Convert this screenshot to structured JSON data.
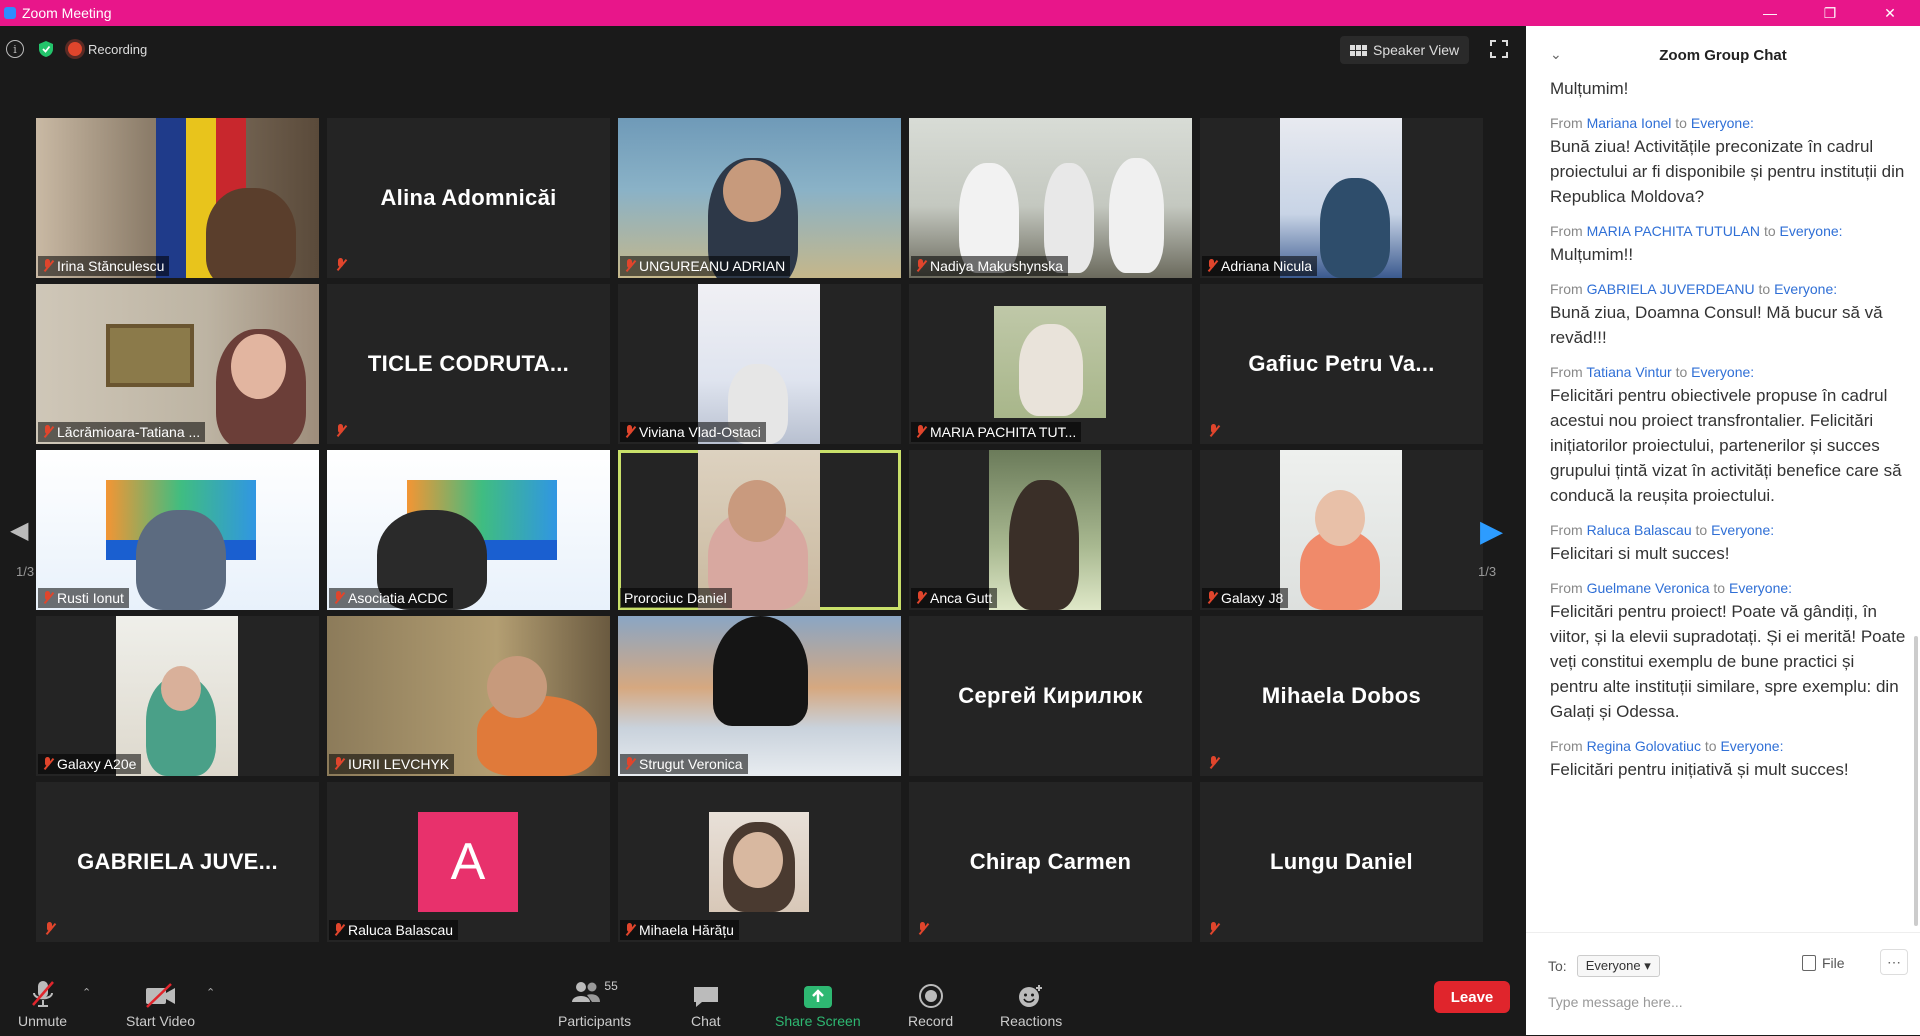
{
  "window": {
    "title": "Zoom Meeting"
  },
  "topbar": {
    "recording_label": "Recording",
    "speaker_view_label": "Speaker View"
  },
  "tiles": [
    {
      "name": "Irina Stănculescu",
      "big_name": ""
    },
    {
      "name": "",
      "big_name": "Alina Adomnicăi"
    },
    {
      "name": "UNGUREANU ADRIAN",
      "big_name": ""
    },
    {
      "name": "Nadiya Makushynska",
      "big_name": ""
    },
    {
      "name": "Adriana Nicula",
      "big_name": ""
    },
    {
      "name": "Lăcrămioara-Tatiana ...",
      "big_name": ""
    },
    {
      "name": "",
      "big_name": "TICLE  CODRUTA..."
    },
    {
      "name": "Viviana Vlad-Ostaci",
      "big_name": ""
    },
    {
      "name": "MARIA PACHITA TUT...",
      "big_name": ""
    },
    {
      "name": "",
      "big_name": "Gafiuc Petru Va..."
    },
    {
      "name": "Rusti Ionut",
      "big_name": ""
    },
    {
      "name": "Asociatia ACDC",
      "big_name": ""
    },
    {
      "name": "Prorociuc Daniel",
      "big_name": ""
    },
    {
      "name": "Anca Gutt",
      "big_name": ""
    },
    {
      "name": "Galaxy J8",
      "big_name": ""
    },
    {
      "name": "Galaxy A20e",
      "big_name": ""
    },
    {
      "name": "IURII LEVCHYK",
      "big_name": ""
    },
    {
      "name": "Strugut Veronica",
      "big_name": ""
    },
    {
      "name": "",
      "big_name": "Сергей Кирилюк"
    },
    {
      "name": "",
      "big_name": "Mihaela Dobos"
    },
    {
      "name": "",
      "big_name": "GABRIELA  JUVE..."
    },
    {
      "name": "Raluca Balascau",
      "big_name": "",
      "avatar_letter": "A"
    },
    {
      "name": "Mihaela Hărățu",
      "big_name": ""
    },
    {
      "name": "",
      "big_name": "Chirap Carmen"
    },
    {
      "name": "",
      "big_name": "Lungu Daniel"
    }
  ],
  "pagination": {
    "left": "1/3",
    "right": "1/3"
  },
  "toolbar": {
    "unmute": "Unmute",
    "start_video": "Start Video",
    "participants": "Participants",
    "participants_count": "55",
    "chat": "Chat",
    "share_screen": "Share Screen",
    "record": "Record",
    "reactions": "Reactions",
    "leave": "Leave"
  },
  "chat": {
    "title": "Zoom Group Chat",
    "top_partial": "Mulțumim!",
    "from_word": "From",
    "to_word": "to",
    "messages": [
      {
        "from": "Mariana Ionel",
        "to": "Everyone:",
        "text": "Bună ziua! Activitățile preconizate în cadrul proiectului ar fi disponibile și pentru instituții din Republica Moldova?"
      },
      {
        "from": "MARIA PACHITA TUTULAN",
        "to": "Everyone:",
        "text": "Mulțumim!!"
      },
      {
        "from": "GABRIELA JUVERDEANU",
        "to": "Everyone:",
        "text": "Bună ziua, Doamna Consul! Mă bucur să vă revăd!!!"
      },
      {
        "from": "Tatiana Vintur",
        "to": "Everyone:",
        "text": "Felicitări pentru obiectivele propuse în cadrul acestui nou proiect transfrontalier. Felicitări inițiatorilor proiectului, partenerilor și succes grupului țintă vizat în activități benefice care să  conducă la reușita proiectului."
      },
      {
        "from": "Raluca Balascau",
        "to": "Everyone:",
        "text": "Felicitari si mult succes!"
      },
      {
        "from": "Guelmane Veronica",
        "to": "Everyone:",
        "text": "Felicitări pentru proiect! Poate vă gândiți, în viitor, și la elevii supradotați. Și ei merită! Poate veți constitui exemplu de bune practici și pentru alte instituții similare, spre exemplu: din Galați și Odessa."
      },
      {
        "from": "Regina Golovatiuc",
        "to": "Everyone:",
        "text": "Felicitări pentru inițiativă și mult succes!"
      }
    ],
    "to_label": "To:",
    "recipient": "Everyone",
    "file_label": "File",
    "input_placeholder": "Type message here..."
  }
}
